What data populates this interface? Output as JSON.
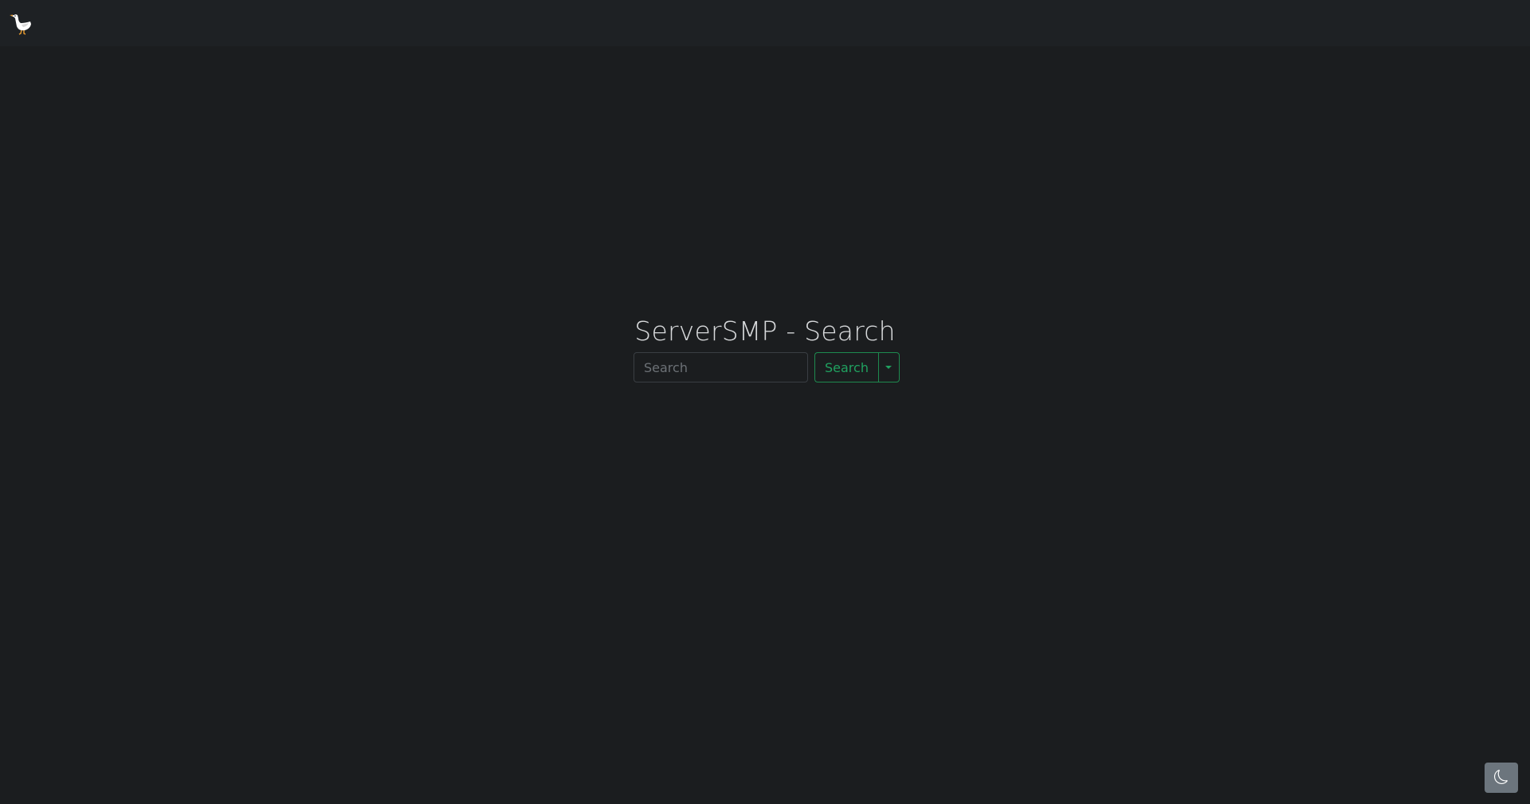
{
  "header": {
    "logo_icon": "goose-icon"
  },
  "main": {
    "title": "ServerSMP - Search",
    "search": {
      "placeholder": "Search",
      "value": "",
      "button_label": "Search",
      "dropdown_icon": "caret-down-icon"
    }
  },
  "theme_toggle": {
    "icon": "moon-icon"
  },
  "colors": {
    "background": "#1b1d1f",
    "topbar": "#1e2124",
    "accent": "#20a160",
    "theme_button": "#6c757d"
  }
}
